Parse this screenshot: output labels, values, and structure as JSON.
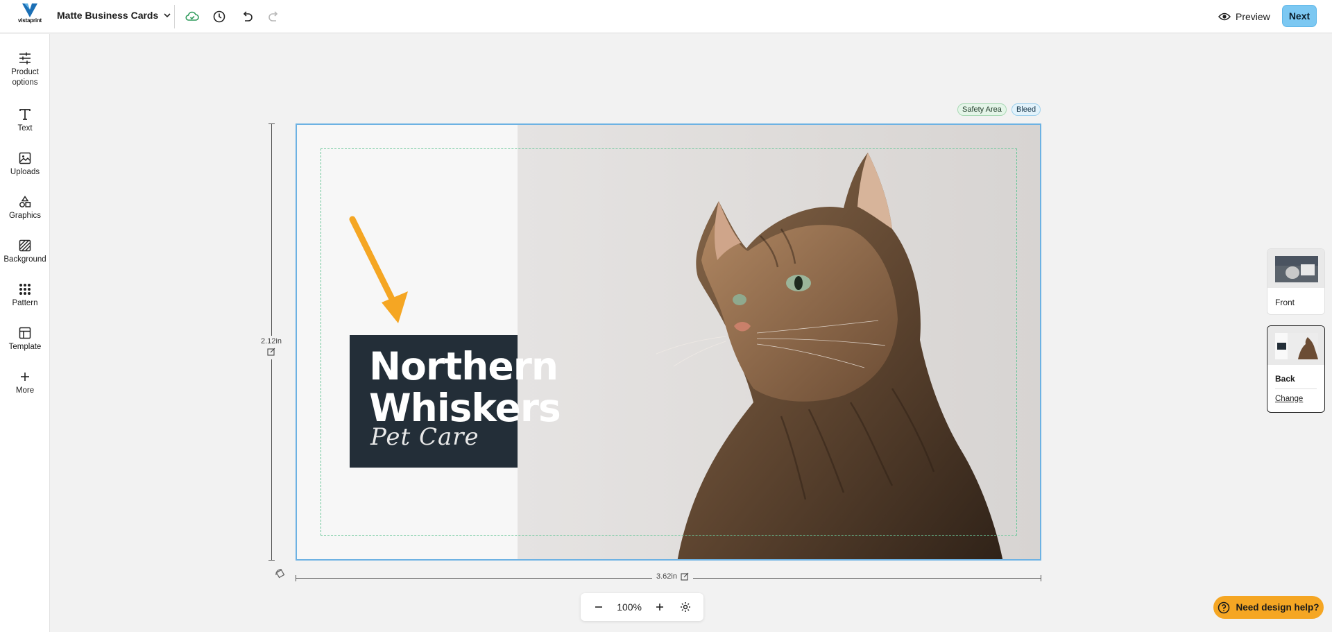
{
  "header": {
    "logo_text": "vistaprint",
    "product_title": "Matte Business Cards",
    "preview_label": "Preview",
    "next_label": "Next",
    "icons": [
      "cloud-save-icon",
      "history-icon",
      "undo-icon",
      "redo-icon",
      "chevron-down-icon",
      "eye-icon"
    ]
  },
  "sidebar": {
    "items": [
      {
        "label": "Product options",
        "icon": "sliders-icon"
      },
      {
        "label": "Text",
        "icon": "text-icon"
      },
      {
        "label": "Uploads",
        "icon": "image-icon"
      },
      {
        "label": "Graphics",
        "icon": "shapes-icon"
      },
      {
        "label": "Background",
        "icon": "background-icon"
      },
      {
        "label": "Pattern",
        "icon": "pattern-icon"
      },
      {
        "label": "Template",
        "icon": "template-icon"
      },
      {
        "label": "More",
        "icon": "plus-icon"
      }
    ]
  },
  "canvas": {
    "safety_label": "Safety Area",
    "bleed_label": "Bleed",
    "height_label": "2.12in",
    "width_label": "3.62in",
    "design": {
      "title_line1": "Northern",
      "title_line2": "Whiskers",
      "subtitle": "Pet Care"
    },
    "colors": {
      "brand_box": "#232e38",
      "safety_line": "#6bc79a",
      "bleed_line": "#6db2e3",
      "arrow": "#f5a623"
    }
  },
  "zoom": {
    "value": "100%",
    "icons": [
      "minus-icon",
      "plus-icon",
      "gear-icon"
    ]
  },
  "pages": {
    "front_label": "Front",
    "back_label": "Back",
    "change_label": "Change",
    "selected": "Back"
  },
  "help": {
    "label": "Need design help?",
    "icon": "question-icon",
    "color": "#f5a623"
  }
}
